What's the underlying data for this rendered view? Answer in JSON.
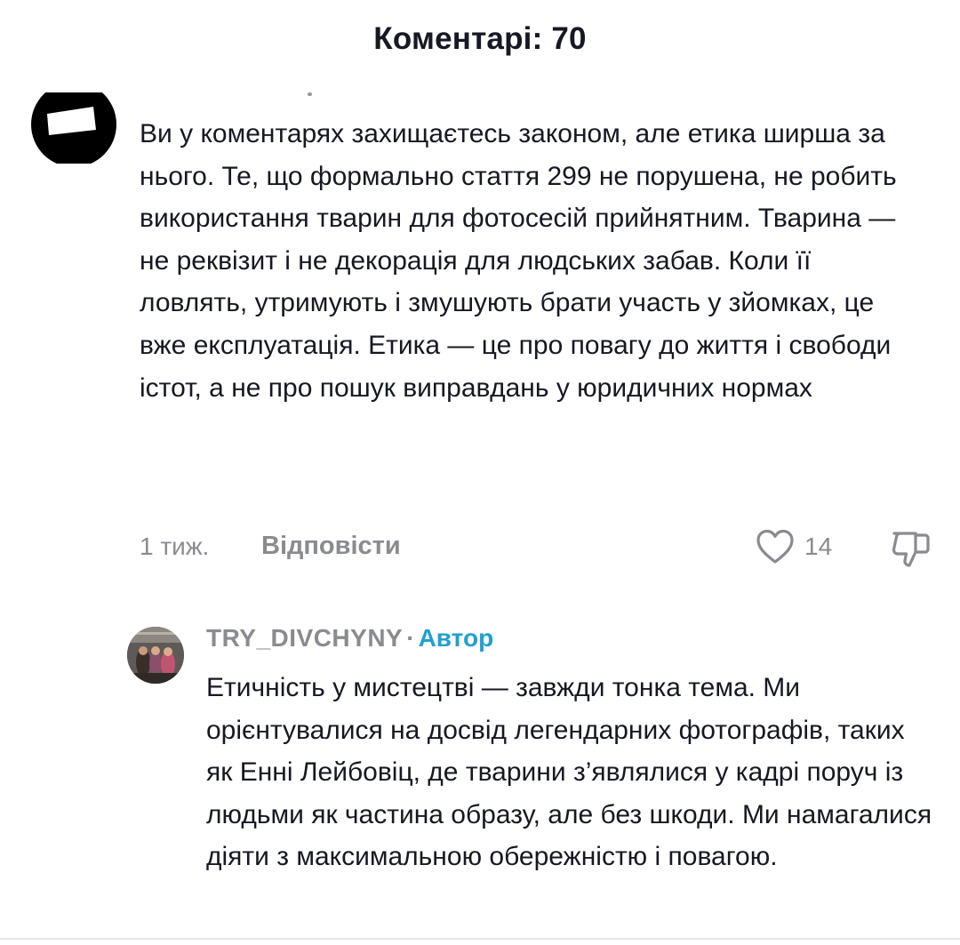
{
  "header": {
    "title": "Коментарі: 70"
  },
  "comment": {
    "avatar_icon": "avatar-image",
    "text": "Ви у коментарях захищаєтесь законом, але етика ширша за нього. Те, що формально стаття 299 не порушена, не робить використання тварин для фотосесій прийнятним. Тварина — не реквізит і не декорація для людських забав. Коли її ловлять, утримують і змушують брати участь у зйомках, це вже експлуатація. Етика — це про повагу до життя і свободи істот, а не про пошук виправдань у юридичних нормах",
    "time": "1 тиж.",
    "reply_label": "Відповісти",
    "like_icon": "heart-icon",
    "like_count": "14",
    "dislike_icon": "thumbs-down-icon"
  },
  "reply": {
    "avatar_icon": "avatar-image",
    "username": "TRY_DIVCHYNY",
    "separator": "·",
    "author_badge": "Автор",
    "text": "Етичність у мистецтві — завжди тонка тема. Ми орієнтувалися на досвід легендарних фотографів, таких як Енні Лейбовіц, де тварини з’являлися у кадрі поруч із людьми як частина образу, але без шкоди. Ми намагалися діяти з максимальною обережністю і повагою."
  },
  "colors": {
    "text": "#161823",
    "muted": "#8a8b91",
    "author_accent": "#20a0d0"
  }
}
